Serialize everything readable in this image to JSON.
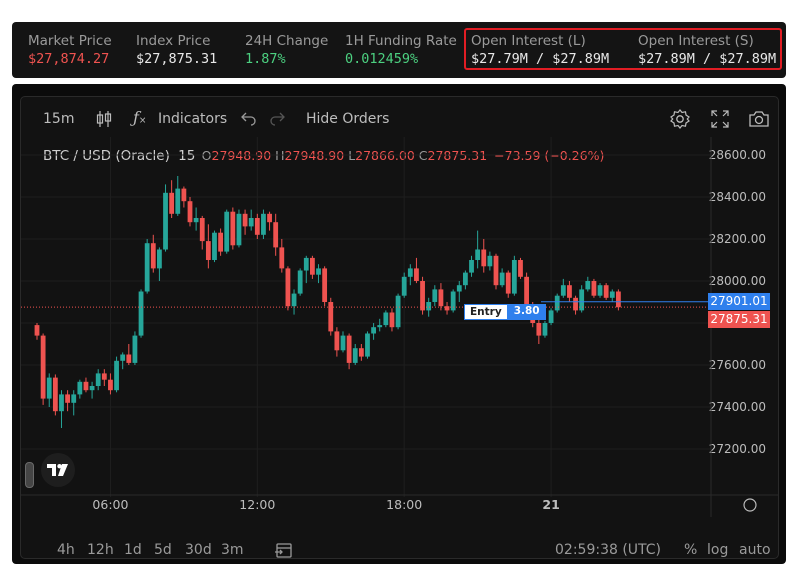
{
  "stats": {
    "market_price": {
      "label": "Market Price",
      "value": "$27,874.27"
    },
    "index_price": {
      "label": "Index Price",
      "value": "$27,875.31"
    },
    "change_24h": {
      "label": "24H Change",
      "value": "1.87%"
    },
    "funding_rate": {
      "label": "1H Funding Rate",
      "value": "0.012459%"
    },
    "oi_long": {
      "label": "Open Interest (L)",
      "value": "$27.79M / $27.89M"
    },
    "oi_short": {
      "label": "Open Interest (S)",
      "value": "$27.89M / $27.89M"
    }
  },
  "colors": {
    "up": "#26a69a",
    "down": "#ef5350",
    "accent": "#2f80ed",
    "highlight": "#e11d24"
  },
  "toolbar": {
    "interval": "15m",
    "indicators": "Indicators",
    "hide_orders": "Hide Orders",
    "icons": [
      "candles-icon",
      "fx-icon",
      "undo-icon",
      "redo-icon",
      "gear-icon",
      "fullscreen-icon",
      "camera-icon"
    ]
  },
  "legend": {
    "symbol": "BTC / USD (Oracle)",
    "interval": "15",
    "o_label": "O",
    "o": "27948.90",
    "h_label": "H",
    "h": "27948.90",
    "l_label": "L",
    "l": "27866.00",
    "c_label": "C",
    "c": "27875.31",
    "change": "−73.59 (−0.26%)"
  },
  "entry": {
    "label": "Entry",
    "size": "3.80",
    "price": "27901.01"
  },
  "last_price": "27875.31",
  "time_display": "02:59:38 (UTC)",
  "ranges": [
    "4h",
    "12h",
    "1d",
    "5d",
    "30d",
    "3m"
  ],
  "scale_buttons": [
    "%",
    "log",
    "auto"
  ],
  "chart_data": {
    "type": "candlestick",
    "ylim": [
      27100,
      28650
    ],
    "y_ticks": [
      27200,
      27400,
      27600,
      27800,
      28000,
      28200,
      28400,
      28600
    ],
    "y_tick_labels": [
      "27200.00",
      "27400.00",
      "27600.00",
      "27800.00",
      "28000.00",
      "28200.00",
      "28400.00",
      "28600.00"
    ],
    "x_tick_labels": [
      "06:00",
      "12:00",
      "18:00",
      "21"
    ],
    "x_tick_index": [
      12,
      36,
      60,
      84
    ],
    "series": [
      {
        "ohlc": [
          [
            27790,
            27800,
            27720,
            27740
          ],
          [
            27740,
            27750,
            27410,
            27440
          ],
          [
            27440,
            27560,
            27400,
            27540
          ],
          [
            27540,
            27555,
            27360,
            27380
          ],
          [
            27380,
            27480,
            27300,
            27460
          ],
          [
            27460,
            27480,
            27380,
            27420
          ],
          [
            27420,
            27480,
            27360,
            27460
          ],
          [
            27460,
            27530,
            27440,
            27520
          ],
          [
            27520,
            27540,
            27470,
            27480
          ],
          [
            27480,
            27520,
            27440,
            27500
          ],
          [
            27500,
            27580,
            27480,
            27560
          ],
          [
            27560,
            27580,
            27500,
            27530
          ],
          [
            27530,
            27560,
            27460,
            27480
          ],
          [
            27480,
            27640,
            27470,
            27620
          ],
          [
            27620,
            27660,
            27580,
            27650
          ],
          [
            27650,
            27700,
            27600,
            27610
          ],
          [
            27610,
            27760,
            27600,
            27740
          ],
          [
            27740,
            27960,
            27730,
            27950
          ],
          [
            27950,
            28200,
            27940,
            28180
          ],
          [
            28180,
            28220,
            28040,
            28060
          ],
          [
            28060,
            28160,
            28000,
            28150
          ],
          [
            28150,
            28460,
            28140,
            28420
          ],
          [
            28420,
            28480,
            28300,
            28320
          ],
          [
            28320,
            28500,
            28310,
            28440
          ],
          [
            28440,
            28450,
            28350,
            28380
          ],
          [
            28380,
            28400,
            28260,
            28280
          ],
          [
            28280,
            28350,
            28240,
            28300
          ],
          [
            28300,
            28310,
            28150,
            28190
          ],
          [
            28190,
            28270,
            28060,
            28100
          ],
          [
            28100,
            28240,
            28090,
            28230
          ],
          [
            28230,
            28250,
            28120,
            28140
          ],
          [
            28140,
            28340,
            28130,
            28330
          ],
          [
            28330,
            28350,
            28150,
            28170
          ],
          [
            28170,
            28340,
            28160,
            28320
          ],
          [
            28320,
            28340,
            28220,
            28260
          ],
          [
            28260,
            28340,
            28240,
            28300
          ],
          [
            28300,
            28320,
            28200,
            28220
          ],
          [
            28220,
            28340,
            28200,
            28320
          ],
          [
            28320,
            28330,
            28240,
            28280
          ],
          [
            28280,
            28320,
            28120,
            28160
          ],
          [
            28160,
            28200,
            28040,
            28060
          ],
          [
            28060,
            28070,
            27860,
            27880
          ],
          [
            27880,
            27960,
            27840,
            27940
          ],
          [
            27940,
            28060,
            27930,
            28050
          ],
          [
            28050,
            28120,
            27990,
            28110
          ],
          [
            28110,
            28120,
            28010,
            28030
          ],
          [
            28030,
            28080,
            27990,
            28060
          ],
          [
            28060,
            28070,
            27880,
            27900
          ],
          [
            27900,
            27920,
            27740,
            27760
          ],
          [
            27760,
            27780,
            27640,
            27670
          ],
          [
            27670,
            27760,
            27660,
            27740
          ],
          [
            27740,
            27750,
            27580,
            27610
          ],
          [
            27610,
            27700,
            27600,
            27680
          ],
          [
            27680,
            27700,
            27620,
            27640
          ],
          [
            27640,
            27760,
            27630,
            27750
          ],
          [
            27750,
            27800,
            27720,
            27780
          ],
          [
            27780,
            27820,
            27760,
            27790
          ],
          [
            27790,
            27860,
            27780,
            27850
          ],
          [
            27850,
            27870,
            27760,
            27780
          ],
          [
            27780,
            27940,
            27770,
            27930
          ],
          [
            27930,
            28040,
            27920,
            28020
          ],
          [
            28020,
            28080,
            27980,
            28060
          ],
          [
            28060,
            28110,
            27990,
            28000
          ],
          [
            28000,
            28020,
            27840,
            27860
          ],
          [
            27860,
            27920,
            27830,
            27900
          ],
          [
            27900,
            27980,
            27880,
            27960
          ],
          [
            27960,
            27990,
            27860,
            27880
          ],
          [
            27880,
            27900,
            27840,
            27860
          ],
          [
            27860,
            27960,
            27850,
            27950
          ],
          [
            27950,
            28000,
            27900,
            27980
          ],
          [
            27980,
            28050,
            27960,
            28040
          ],
          [
            28040,
            28120,
            28020,
            28100
          ],
          [
            28100,
            28240,
            28060,
            28150
          ],
          [
            28150,
            28200,
            28040,
            28070
          ],
          [
            28070,
            28140,
            28050,
            28120
          ],
          [
            28120,
            28130,
            27960,
            27980
          ],
          [
            27980,
            28060,
            27970,
            28040
          ],
          [
            28040,
            28050,
            27920,
            27940
          ],
          [
            27940,
            28120,
            27930,
            28100
          ],
          [
            28100,
            28110,
            28010,
            28020
          ],
          [
            28020,
            28040,
            27860,
            27880
          ],
          [
            27880,
            27900,
            27780,
            27800
          ],
          [
            27800,
            27830,
            27700,
            27740
          ],
          [
            27740,
            27810,
            27730,
            27800
          ],
          [
            27800,
            27870,
            27790,
            27860
          ],
          [
            27860,
            27940,
            27850,
            27930
          ],
          [
            27930,
            28010,
            27920,
            27980
          ],
          [
            27980,
            28000,
            27900,
            27920
          ],
          [
            27920,
            27930,
            27840,
            27860
          ],
          [
            27860,
            27980,
            27850,
            27960
          ],
          [
            27960,
            28020,
            27950,
            28000
          ],
          [
            28000,
            28010,
            27920,
            27930
          ],
          [
            27930,
            27990,
            27920,
            27980
          ],
          [
            27980,
            27990,
            27910,
            27920
          ],
          [
            27920,
            27960,
            27900,
            27950
          ],
          [
            27950,
            27960,
            27860,
            27875
          ]
        ]
      }
    ]
  }
}
